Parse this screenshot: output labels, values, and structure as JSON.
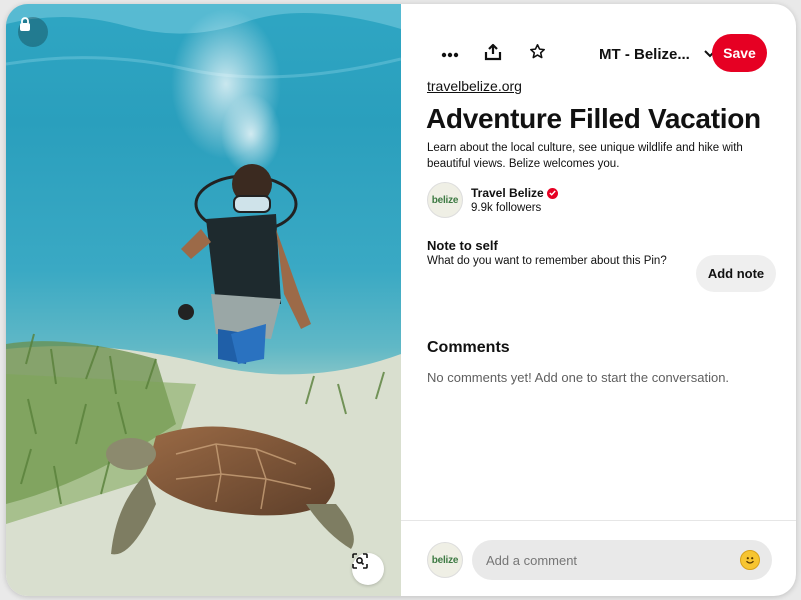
{
  "image": {
    "description_icon": "lock-icon",
    "lens_icon": "visual-search-icon"
  },
  "toolbar": {
    "more_icon": "ellipsis-icon",
    "share_icon": "share-icon",
    "favorite_icon": "star-icon",
    "board_name": "MT - Belize...",
    "board_chevron_icon": "chevron-down-icon",
    "save_label": "Save"
  },
  "pin": {
    "source": "travelbelize.org",
    "title": "Adventure Filled Vacation",
    "description": "Learn about the local culture, see unique wildlife and hike with beautiful views. Belize welcomes you."
  },
  "creator": {
    "name": "Travel Belize",
    "followers": "9.9k followers",
    "avatar_text": "belize",
    "verified_icon": "verified-badge-icon"
  },
  "note": {
    "title": "Note to self",
    "prompt": "What do you want to remember about this Pin?",
    "button_label": "Add note"
  },
  "comments": {
    "title": "Comments",
    "empty_text": "No comments yet! Add one to start the conversation.",
    "input_placeholder": "Add a comment",
    "emoji_icon": "smiley-emoji-icon"
  },
  "colors": {
    "save_red": "#e60023",
    "pill_gray": "#efefef"
  }
}
